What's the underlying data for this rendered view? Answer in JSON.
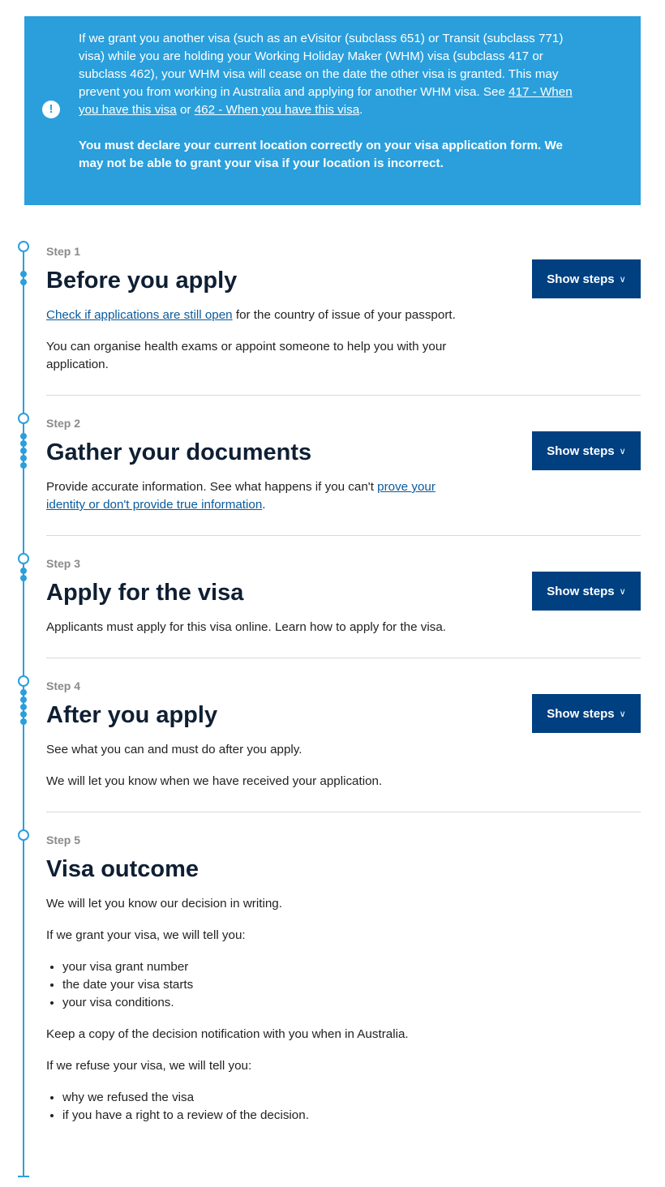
{
  "notice": {
    "icon": "info-icon",
    "p1_text1": "If we grant you another visa (such as an eVisitor (subclass 651) or Transit (subclass 771) visa) while you are holding your Working Holiday Maker (WHM) visa (subclass 417 or subclass 462), your WHM visa will cease on the date the other visa is granted. This may prevent you from working in Australia and applying for another WHM visa. See ",
    "link1": "417 - When you have this visa",
    "p1_or": " or ",
    "link2": "462 - When you have this visa",
    "p1_end": ".",
    "p2": "You must declare your current location correctly on your visa application form. We may not be able to grant your visa if your location is incorrect."
  },
  "steps": {
    "s1": {
      "label": "Step 1",
      "title": "Before you apply",
      "button": "Show steps",
      "link": "Check if applications are still open",
      "text1_rest": " for the country of issue of your passport.",
      "text2": "You can organise health exams or appoint someone to help you with your application."
    },
    "s2": {
      "label": "Step 2",
      "title": "Gather your documents",
      "button": "Show steps",
      "text_pre": "Provide accurate information. See what happens if you can't ",
      "link": "prove your identity or don't provide true information",
      "text_end": "."
    },
    "s3": {
      "label": "Step 3",
      "title": "Apply for the visa",
      "button": "Show steps",
      "text": "Applicants must apply for this visa online. Learn how to apply for the visa."
    },
    "s4": {
      "label": "Step 4",
      "title": "After you apply",
      "button": "Show steps",
      "text1": "See what you can and must do after you apply.",
      "text2": "We will let you know when we have received your application."
    },
    "s5": {
      "label": "Step 5",
      "title": "Visa outcome",
      "text1": "We will let you know our decision in writing.",
      "text2": "If we grant your visa, we will tell you:",
      "grant_items": [
        "your visa grant number",
        "the date your visa starts",
        "your visa conditions."
      ],
      "text3": "Keep a copy of the decision notification with you when in Australia.",
      "text4": "If we refuse your visa, we will tell you:",
      "refuse_items": [
        "why we refused the visa",
        "if you have a right to a review of the decision."
      ]
    }
  },
  "colors": {
    "notice_bg": "#2a9fdc",
    "button_bg": "#004080",
    "link": "#0a5a9c",
    "heading": "#0f1f33"
  }
}
